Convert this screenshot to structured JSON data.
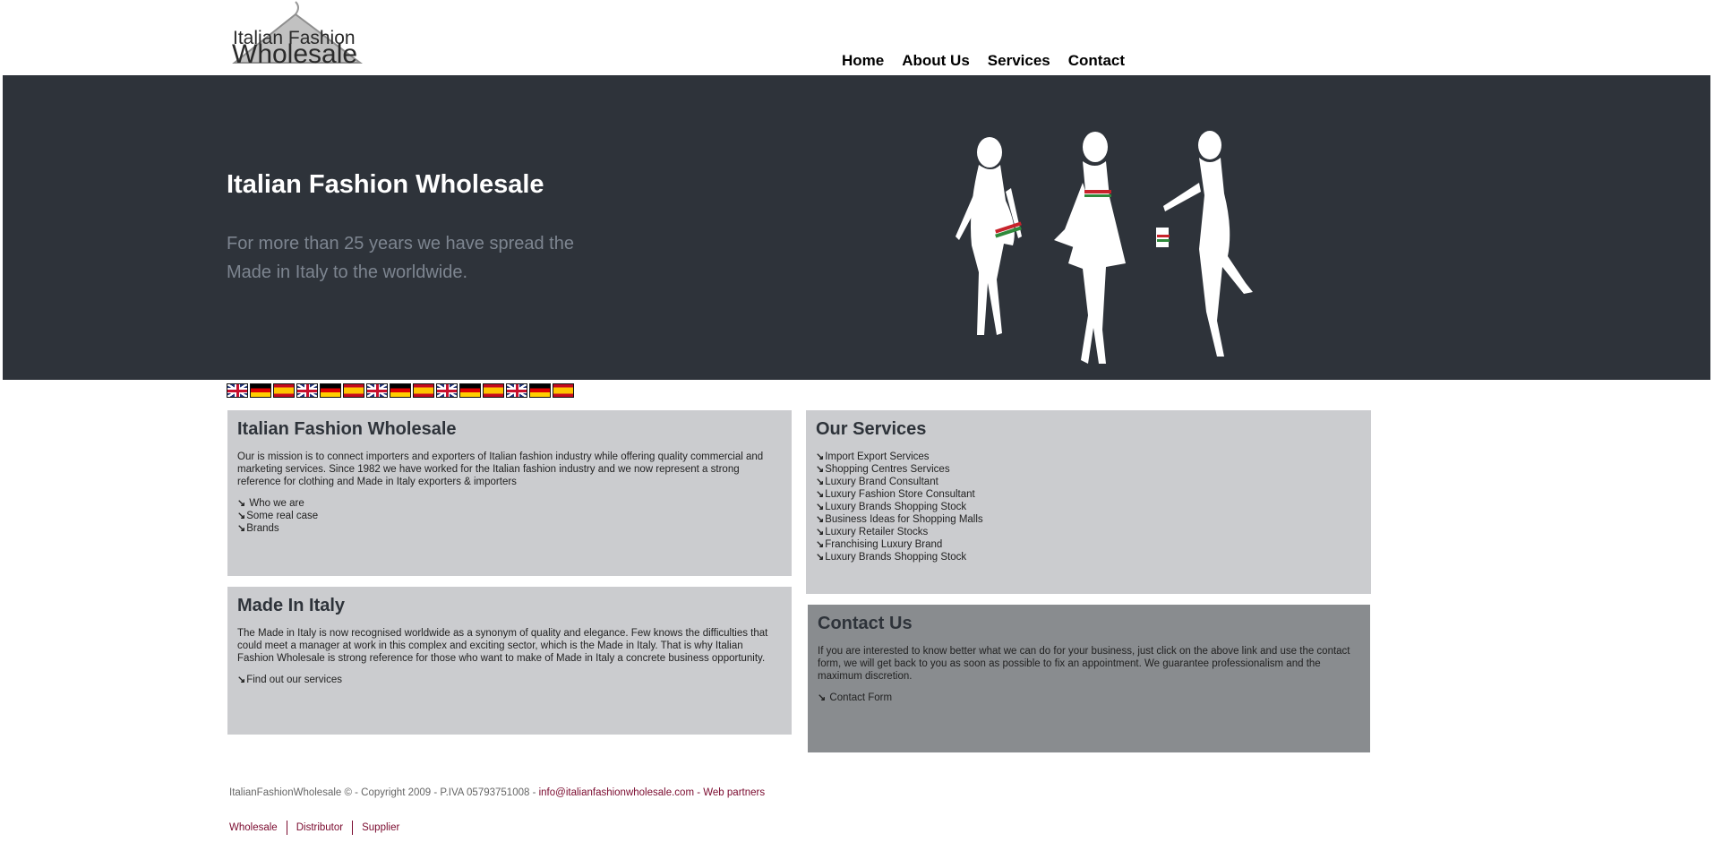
{
  "logo": {
    "line1": "Italian Fashion",
    "line2": "Wholesale"
  },
  "nav": {
    "items": [
      "Home",
      "About Us",
      "Services",
      "Contact"
    ]
  },
  "hero": {
    "title": "Italian Fashion Wholesale",
    "subtitle": "For more than 25 years we have spread the Made in Italy to the worldwide."
  },
  "flags": [
    "uk",
    "de",
    "es",
    "uk",
    "de",
    "es",
    "uk",
    "de",
    "es",
    "uk",
    "de",
    "es",
    "uk",
    "de",
    "es"
  ],
  "about_box": {
    "title": "Italian Fashion Wholesale",
    "text": "Our is mission is to connect importers and exporters of Italian fashion industry while offering quality commercial and marketing services. Since 1982 we have worked for the Italian fashion industry and we now represent a strong reference for clothing and Made in Italy exporters & importers",
    "links": [
      " Who we are",
      "Some real case",
      "Brands"
    ]
  },
  "services_box": {
    "title": "Our Services",
    "links": [
      "Import Export Services",
      "Shopping Centres Services",
      "Luxury Brand Consultant",
      "Luxury Fashion Store Consultant",
      "Luxury Brands Shopping Stock",
      "Business Ideas for Shopping Malls",
      "Luxury Retailer Stocks",
      "Franchising Luxury Brand",
      "Luxury Brands Shopping Stock"
    ]
  },
  "made_box": {
    "title": "Made In Italy",
    "text": "The Made in Italy is now recognised worldwide as a synonym of quality and elegance. Few knows the difficulties that could meet a manager at work in this complex and exciting sector, which is the Made in Italy. That is why Italian Fashion Wholesale is strong reference for those who want to make of Made in Italy a concrete business opportunity.",
    "links": [
      "Find out our services"
    ]
  },
  "contact_box": {
    "title": "Contact Us",
    "text": "If you are interested to know better what we can do for your business, just click on the above link and use the contact form, we will get back to you as soon as possible to fix an appointment. We guarantee professionalism and the maximum discretion.",
    "links": [
      " Contact Form"
    ]
  },
  "footer": {
    "copyright": "ItalianFashionWholesale © - Copyright 2009 - P.IVA 05793751008 - ",
    "email": "info@italianfashionwholesale.com",
    "separator": " - ",
    "partners": "Web partners",
    "links": [
      "Wholesale",
      "Distributor",
      "Supplier"
    ]
  },
  "colors": {
    "hero_bg": "#2e333a",
    "box_bg": "#cbcccf",
    "box_dark_bg": "#898c8f",
    "link": "#7a0a2e"
  },
  "icons": {
    "list_bullet": "arrow-down-right-icon"
  }
}
